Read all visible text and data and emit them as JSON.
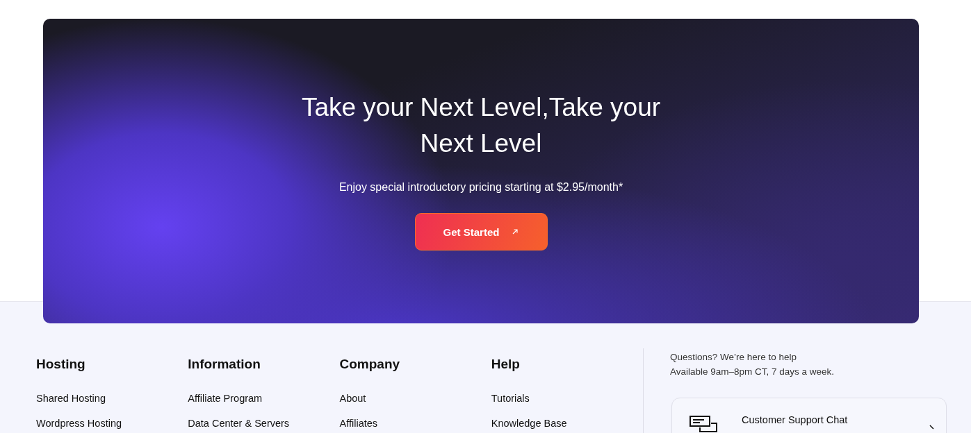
{
  "banner": {
    "title": "Take your Next Level,Take your Next Level",
    "subtitle": "Enjoy special introductory pricing starting at $2.95/month*",
    "button": "Get Started"
  },
  "footer": {
    "columns": [
      {
        "heading": "Hosting",
        "links": [
          "Shared Hosting",
          "Wordpress Hosting"
        ]
      },
      {
        "heading": "Information",
        "links": [
          "Affiliate Program",
          "Data Center & Servers"
        ]
      },
      {
        "heading": "Company",
        "links": [
          "About",
          "Affiliates"
        ]
      },
      {
        "heading": "Help",
        "links": [
          "Tutorials",
          "Knowledge Base"
        ]
      }
    ],
    "contact": {
      "lines": [
        "Questions? We’re here to help",
        "Available 9am–8pm CT, 7 days a week."
      ],
      "card": {
        "label": "Customer Support Chat"
      }
    }
  }
}
